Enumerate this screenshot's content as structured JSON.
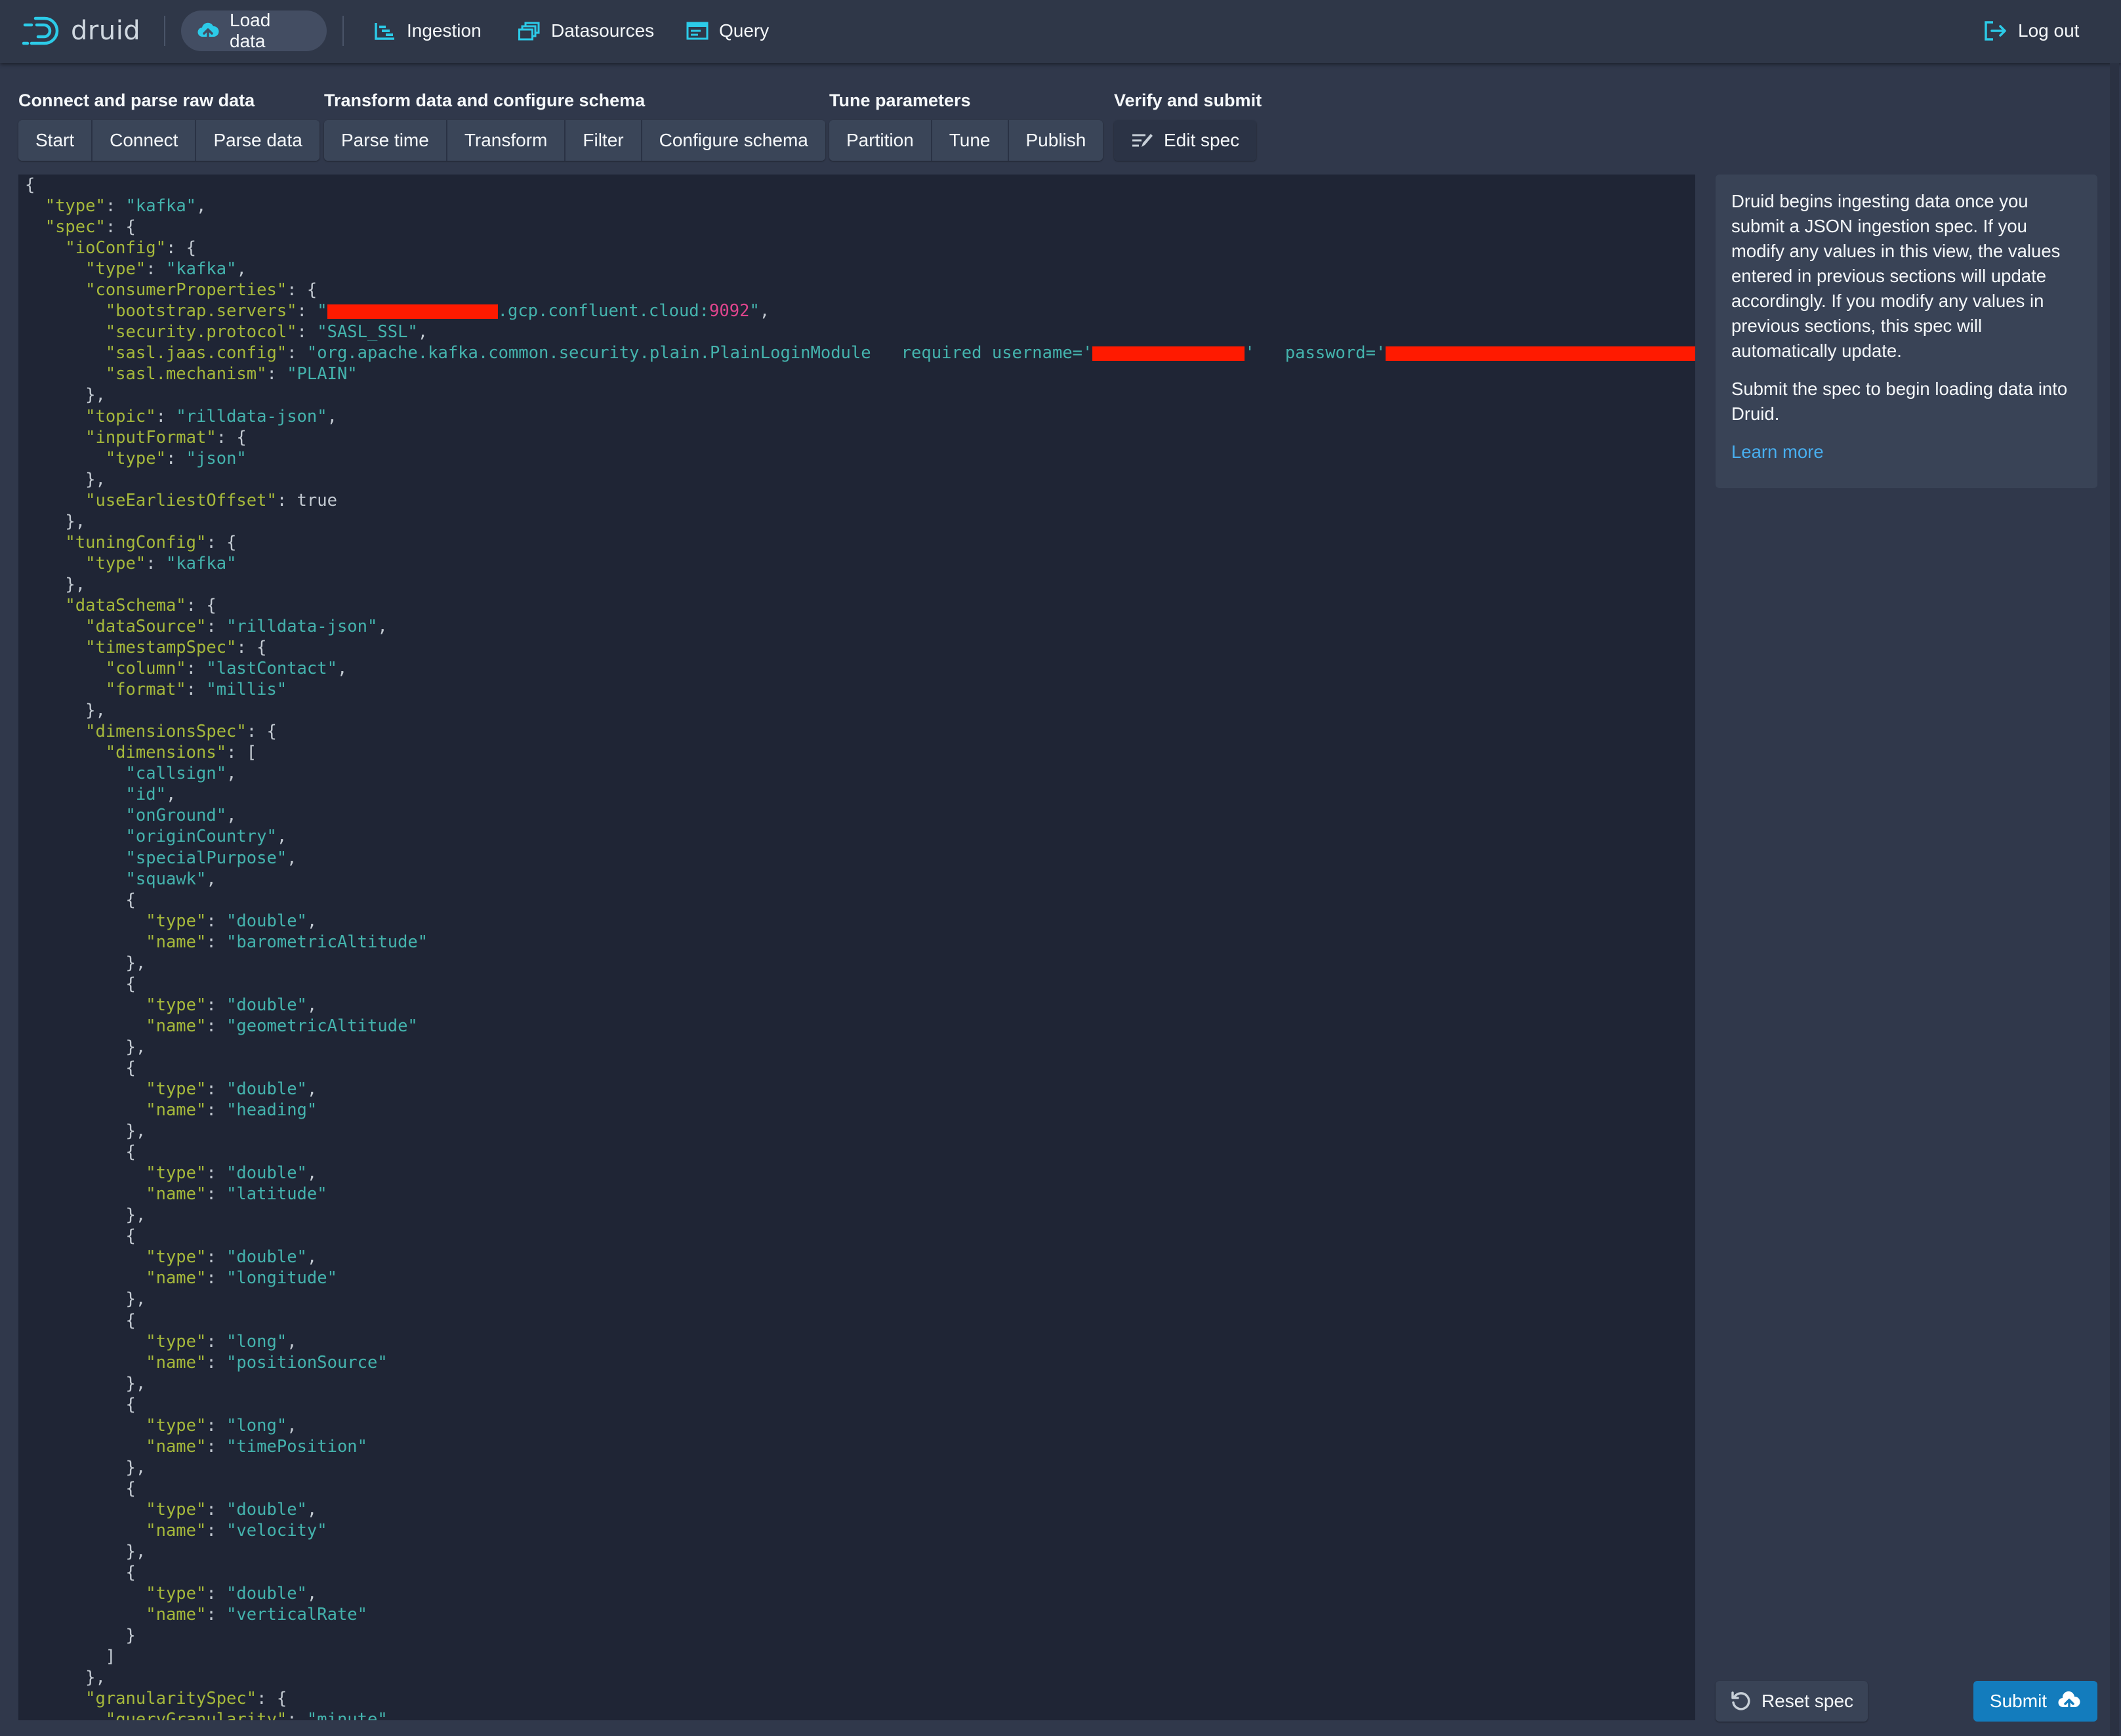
{
  "navbar": {
    "logo_text": "druid",
    "items": [
      {
        "label": "Load data",
        "icon": "cloud-upload-icon",
        "active": true
      },
      {
        "label": "Ingestion",
        "icon": "gantt-chart-icon"
      },
      {
        "label": "Datasources",
        "icon": "multi-select-icon"
      },
      {
        "label": "Query",
        "icon": "application-icon"
      }
    ],
    "logout_label": "Log out"
  },
  "steps": {
    "groups": [
      {
        "title": "Connect and parse raw data",
        "buttons": [
          "Start",
          "Connect",
          "Parse data"
        ]
      },
      {
        "title": "Transform data and configure schema",
        "buttons": [
          "Parse time",
          "Transform",
          "Filter",
          "Configure schema"
        ]
      },
      {
        "title": "Tune parameters",
        "buttons": [
          "Partition",
          "Tune",
          "Publish"
        ]
      },
      {
        "title": "Verify and submit",
        "buttons": [
          "Edit spec"
        ]
      }
    ],
    "current": "Edit spec"
  },
  "spec_lines": [
    [
      [
        "p",
        "{"
      ]
    ],
    [
      [
        "p",
        "  "
      ],
      [
        "k",
        "\"type\""
      ],
      [
        "p",
        ": "
      ],
      [
        "s",
        "\"kafka\""
      ],
      [
        "p",
        ","
      ]
    ],
    [
      [
        "p",
        "  "
      ],
      [
        "k",
        "\"spec\""
      ],
      [
        "p",
        ": {"
      ]
    ],
    [
      [
        "p",
        "    "
      ],
      [
        "k",
        "\"ioConfig\""
      ],
      [
        "p",
        ": {"
      ]
    ],
    [
      [
        "p",
        "      "
      ],
      [
        "k",
        "\"type\""
      ],
      [
        "p",
        ": "
      ],
      [
        "s",
        "\"kafka\""
      ],
      [
        "p",
        ","
      ]
    ],
    [
      [
        "p",
        "      "
      ],
      [
        "k",
        "\"consumerProperties\""
      ],
      [
        "p",
        ": {"
      ]
    ],
    [
      [
        "p",
        "        "
      ],
      [
        "k",
        "\"bootstrap.servers\""
      ],
      [
        "p",
        ": "
      ],
      [
        "s",
        "\""
      ],
      [
        "r",
        "260"
      ],
      [
        "s",
        ".gcp.confluent.cloud:"
      ],
      [
        "n",
        "9092"
      ],
      [
        "s",
        "\""
      ],
      [
        "p",
        ","
      ]
    ],
    [
      [
        "p",
        "        "
      ],
      [
        "k",
        "\"security.protocol\""
      ],
      [
        "p",
        ": "
      ],
      [
        "s",
        "\"SASL_SSL\""
      ],
      [
        "p",
        ","
      ]
    ],
    [
      [
        "p",
        "        "
      ],
      [
        "k",
        "\"sasl.jaas.config\""
      ],
      [
        "p",
        ": "
      ],
      [
        "s",
        "\"org.apache.kafka.common.security.plain.PlainLoginModule   required username='"
      ],
      [
        "r",
        "232"
      ],
      [
        "s",
        "'   password='"
      ],
      [
        "r",
        "580"
      ]
    ],
    [
      [
        "p",
        "        "
      ],
      [
        "k",
        "\"sasl.mechanism\""
      ],
      [
        "p",
        ": "
      ],
      [
        "s",
        "\"PLAIN\""
      ]
    ],
    [
      [
        "p",
        "      },"
      ]
    ],
    [
      [
        "p",
        "      "
      ],
      [
        "k",
        "\"topic\""
      ],
      [
        "p",
        ": "
      ],
      [
        "s",
        "\"rilldata-json\""
      ],
      [
        "p",
        ","
      ]
    ],
    [
      [
        "p",
        "      "
      ],
      [
        "k",
        "\"inputFormat\""
      ],
      [
        "p",
        ": {"
      ]
    ],
    [
      [
        "p",
        "        "
      ],
      [
        "k",
        "\"type\""
      ],
      [
        "p",
        ": "
      ],
      [
        "s",
        "\"json\""
      ]
    ],
    [
      [
        "p",
        "      },"
      ]
    ],
    [
      [
        "p",
        "      "
      ],
      [
        "k",
        "\"useEarliestOffset\""
      ],
      [
        "p",
        ": true"
      ]
    ],
    [
      [
        "p",
        "    },"
      ]
    ],
    [
      [
        "p",
        "    "
      ],
      [
        "k",
        "\"tuningConfig\""
      ],
      [
        "p",
        ": {"
      ]
    ],
    [
      [
        "p",
        "      "
      ],
      [
        "k",
        "\"type\""
      ],
      [
        "p",
        ": "
      ],
      [
        "s",
        "\"kafka\""
      ]
    ],
    [
      [
        "p",
        "    },"
      ]
    ],
    [
      [
        "p",
        "    "
      ],
      [
        "k",
        "\"dataSchema\""
      ],
      [
        "p",
        ": {"
      ]
    ],
    [
      [
        "p",
        "      "
      ],
      [
        "k",
        "\"dataSource\""
      ],
      [
        "p",
        ": "
      ],
      [
        "s",
        "\"rilldata-json\""
      ],
      [
        "p",
        ","
      ]
    ],
    [
      [
        "p",
        "      "
      ],
      [
        "k",
        "\"timestampSpec\""
      ],
      [
        "p",
        ": {"
      ]
    ],
    [
      [
        "p",
        "        "
      ],
      [
        "k",
        "\"column\""
      ],
      [
        "p",
        ": "
      ],
      [
        "s",
        "\"lastContact\""
      ],
      [
        "p",
        ","
      ]
    ],
    [
      [
        "p",
        "        "
      ],
      [
        "k",
        "\"format\""
      ],
      [
        "p",
        ": "
      ],
      [
        "s",
        "\"millis\""
      ]
    ],
    [
      [
        "p",
        "      },"
      ]
    ],
    [
      [
        "p",
        "      "
      ],
      [
        "k",
        "\"dimensionsSpec\""
      ],
      [
        "p",
        ": {"
      ]
    ],
    [
      [
        "p",
        "        "
      ],
      [
        "k",
        "\"dimensions\""
      ],
      [
        "p",
        ": ["
      ]
    ],
    [
      [
        "p",
        "          "
      ],
      [
        "s",
        "\"callsign\""
      ],
      [
        "p",
        ","
      ]
    ],
    [
      [
        "p",
        "          "
      ],
      [
        "s",
        "\"id\""
      ],
      [
        "p",
        ","
      ]
    ],
    [
      [
        "p",
        "          "
      ],
      [
        "s",
        "\"onGround\""
      ],
      [
        "p",
        ","
      ]
    ],
    [
      [
        "p",
        "          "
      ],
      [
        "s",
        "\"originCountry\""
      ],
      [
        "p",
        ","
      ]
    ],
    [
      [
        "p",
        "          "
      ],
      [
        "s",
        "\"specialPurpose\""
      ],
      [
        "p",
        ","
      ]
    ],
    [
      [
        "p",
        "          "
      ],
      [
        "s",
        "\"squawk\""
      ],
      [
        "p",
        ","
      ]
    ],
    [
      [
        "p",
        "          {"
      ]
    ],
    [
      [
        "p",
        "            "
      ],
      [
        "k",
        "\"type\""
      ],
      [
        "p",
        ": "
      ],
      [
        "s",
        "\"double\""
      ],
      [
        "p",
        ","
      ]
    ],
    [
      [
        "p",
        "            "
      ],
      [
        "k",
        "\"name\""
      ],
      [
        "p",
        ": "
      ],
      [
        "s",
        "\"barometricAltitude\""
      ]
    ],
    [
      [
        "p",
        "          },"
      ]
    ],
    [
      [
        "p",
        "          {"
      ]
    ],
    [
      [
        "p",
        "            "
      ],
      [
        "k",
        "\"type\""
      ],
      [
        "p",
        ": "
      ],
      [
        "s",
        "\"double\""
      ],
      [
        "p",
        ","
      ]
    ],
    [
      [
        "p",
        "            "
      ],
      [
        "k",
        "\"name\""
      ],
      [
        "p",
        ": "
      ],
      [
        "s",
        "\"geometricAltitude\""
      ]
    ],
    [
      [
        "p",
        "          },"
      ]
    ],
    [
      [
        "p",
        "          {"
      ]
    ],
    [
      [
        "p",
        "            "
      ],
      [
        "k",
        "\"type\""
      ],
      [
        "p",
        ": "
      ],
      [
        "s",
        "\"double\""
      ],
      [
        "p",
        ","
      ]
    ],
    [
      [
        "p",
        "            "
      ],
      [
        "k",
        "\"name\""
      ],
      [
        "p",
        ": "
      ],
      [
        "s",
        "\"heading\""
      ]
    ],
    [
      [
        "p",
        "          },"
      ]
    ],
    [
      [
        "p",
        "          {"
      ]
    ],
    [
      [
        "p",
        "            "
      ],
      [
        "k",
        "\"type\""
      ],
      [
        "p",
        ": "
      ],
      [
        "s",
        "\"double\""
      ],
      [
        "p",
        ","
      ]
    ],
    [
      [
        "p",
        "            "
      ],
      [
        "k",
        "\"name\""
      ],
      [
        "p",
        ": "
      ],
      [
        "s",
        "\"latitude\""
      ]
    ],
    [
      [
        "p",
        "          },"
      ]
    ],
    [
      [
        "p",
        "          {"
      ]
    ],
    [
      [
        "p",
        "            "
      ],
      [
        "k",
        "\"type\""
      ],
      [
        "p",
        ": "
      ],
      [
        "s",
        "\"double\""
      ],
      [
        "p",
        ","
      ]
    ],
    [
      [
        "p",
        "            "
      ],
      [
        "k",
        "\"name\""
      ],
      [
        "p",
        ": "
      ],
      [
        "s",
        "\"longitude\""
      ]
    ],
    [
      [
        "p",
        "          },"
      ]
    ],
    [
      [
        "p",
        "          {"
      ]
    ],
    [
      [
        "p",
        "            "
      ],
      [
        "k",
        "\"type\""
      ],
      [
        "p",
        ": "
      ],
      [
        "s",
        "\"long\""
      ],
      [
        "p",
        ","
      ]
    ],
    [
      [
        "p",
        "            "
      ],
      [
        "k",
        "\"name\""
      ],
      [
        "p",
        ": "
      ],
      [
        "s",
        "\"positionSource\""
      ]
    ],
    [
      [
        "p",
        "          },"
      ]
    ],
    [
      [
        "p",
        "          {"
      ]
    ],
    [
      [
        "p",
        "            "
      ],
      [
        "k",
        "\"type\""
      ],
      [
        "p",
        ": "
      ],
      [
        "s",
        "\"long\""
      ],
      [
        "p",
        ","
      ]
    ],
    [
      [
        "p",
        "            "
      ],
      [
        "k",
        "\"name\""
      ],
      [
        "p",
        ": "
      ],
      [
        "s",
        "\"timePosition\""
      ]
    ],
    [
      [
        "p",
        "          },"
      ]
    ],
    [
      [
        "p",
        "          {"
      ]
    ],
    [
      [
        "p",
        "            "
      ],
      [
        "k",
        "\"type\""
      ],
      [
        "p",
        ": "
      ],
      [
        "s",
        "\"double\""
      ],
      [
        "p",
        ","
      ]
    ],
    [
      [
        "p",
        "            "
      ],
      [
        "k",
        "\"name\""
      ],
      [
        "p",
        ": "
      ],
      [
        "s",
        "\"velocity\""
      ]
    ],
    [
      [
        "p",
        "          },"
      ]
    ],
    [
      [
        "p",
        "          {"
      ]
    ],
    [
      [
        "p",
        "            "
      ],
      [
        "k",
        "\"type\""
      ],
      [
        "p",
        ": "
      ],
      [
        "s",
        "\"double\""
      ],
      [
        "p",
        ","
      ]
    ],
    [
      [
        "p",
        "            "
      ],
      [
        "k",
        "\"name\""
      ],
      [
        "p",
        ": "
      ],
      [
        "s",
        "\"verticalRate\""
      ]
    ],
    [
      [
        "p",
        "          }"
      ]
    ],
    [
      [
        "p",
        "        ]"
      ]
    ],
    [
      [
        "p",
        "      },"
      ]
    ],
    [
      [
        "p",
        "      "
      ],
      [
        "k",
        "\"granularitySpec\""
      ],
      [
        "p",
        ": {"
      ]
    ],
    [
      [
        "p",
        "        "
      ],
      [
        "k",
        "\"queryGranularity\""
      ],
      [
        "p",
        ": "
      ],
      [
        "s",
        "\"minute\""
      ]
    ]
  ],
  "info": {
    "paragraph1": "Druid begins ingesting data once you submit a JSON ingestion spec. If you modify any values in this view, the values entered in previous sections will update accordingly. If you modify any values in previous sections, this spec will automatically update.",
    "paragraph2": "Submit the spec to begin loading data into Druid.",
    "learn_more": "Learn more"
  },
  "actions": {
    "reset_label": "Reset spec",
    "submit_label": "Submit"
  },
  "colors": {
    "background": "#30384b",
    "editor_bg": "#1f2535",
    "json_key": "#a6b93b",
    "json_string": "#44b3ad",
    "json_number": "#e0458d",
    "primary": "#137cbd",
    "link": "#48aff0",
    "redaction": "#ff1a00"
  }
}
